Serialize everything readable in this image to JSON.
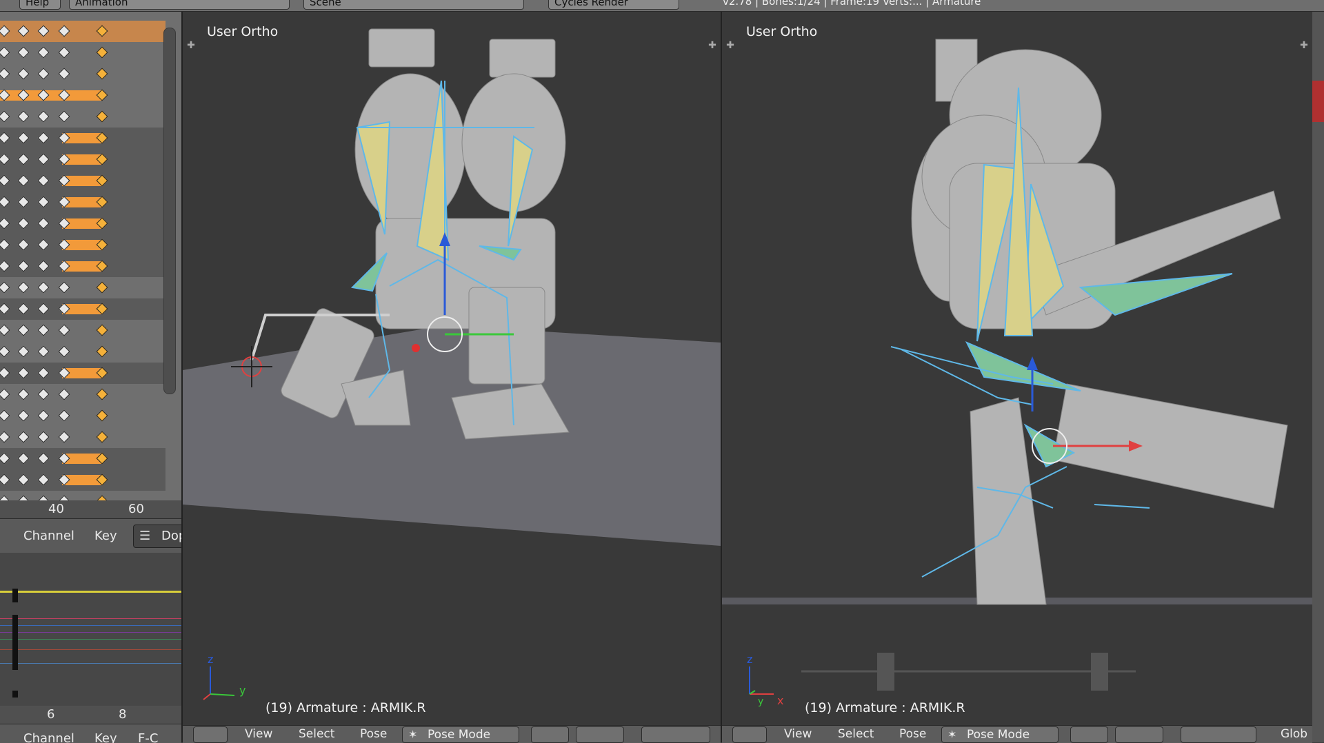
{
  "top_header": {
    "menu_help": "Help",
    "layout_name": "Animation",
    "scene_name": "Scene",
    "render_engine": "Cycles Render",
    "info_stats": "v2.78 | Bones:1/24 | Frame:19 Verts:... | Armature"
  },
  "dopesheet": {
    "ruler_labels": [
      "40",
      "60"
    ],
    "menu": {
      "channel": "Channel",
      "key": "Key",
      "editor_label": "Dop"
    },
    "colors": {
      "bar": "#f29a3a",
      "keyframe": "#e8e8e8",
      "selected_keyframe": "#f5b13a"
    }
  },
  "graph_editor": {
    "ruler_labels": [
      "6",
      "8"
    ],
    "menu": {
      "channel": "Channel",
      "key": "Key",
      "editor_label": "F-C"
    }
  },
  "viewport_left": {
    "view_label": "User Ortho",
    "status": "(19) Armature : ARMIK.R",
    "header": {
      "view": "View",
      "select": "Select",
      "pose": "Pose",
      "mode": "Pose Mode"
    },
    "axes": {
      "x": "",
      "y": "y",
      "z": "z"
    }
  },
  "viewport_right": {
    "view_label": "User Ortho",
    "status": "(19) Armature : ARMIK.R",
    "header": {
      "view": "View",
      "select": "Select",
      "pose": "Pose",
      "mode": "Pose Mode",
      "global": "Glob"
    },
    "axes": {
      "x": "x",
      "y": "y",
      "z": "z"
    }
  },
  "colors": {
    "bone_fill": "#d8d08a",
    "bone_green": "#7fc39a",
    "bone_outline": "#5fb8e8",
    "floor": "#6a6a70",
    "robot": "#b4b4b4"
  }
}
